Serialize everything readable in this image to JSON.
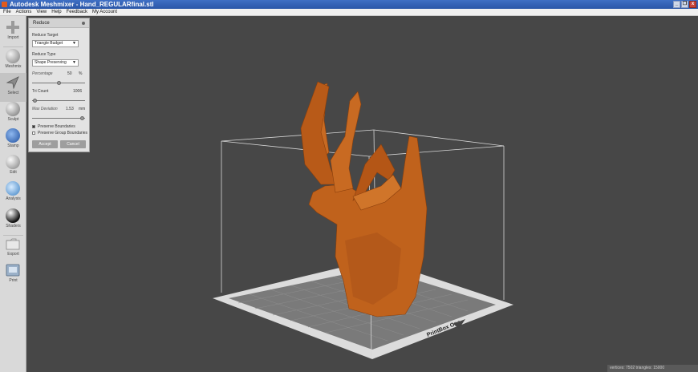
{
  "window": {
    "title": "Autodesk Meshmixer - Hand_REGULARfinal.stl",
    "buttons": [
      "_",
      "❐",
      "x"
    ]
  },
  "menu": [
    "File",
    "Actions",
    "View",
    "Help",
    "Feedback",
    "My Account"
  ],
  "tools": [
    {
      "label": "Import",
      "icon": "plus-icon"
    },
    {
      "label": "Meshmix",
      "icon": "meshmix-sphere-icon"
    },
    {
      "label": "Select",
      "icon": "select-arrow-icon",
      "active": true
    },
    {
      "label": "Sculpt",
      "icon": "sculpt-brush-icon"
    },
    {
      "label": "Stamp",
      "icon": "stamp-icon"
    },
    {
      "label": "Edit",
      "icon": "edit-sphere-icon"
    },
    {
      "label": "Analysis",
      "icon": "analysis-sphere-icon"
    },
    {
      "label": "Shaders",
      "icon": "shaders-sphere-icon"
    },
    {
      "label": "Export",
      "icon": "export-folder-icon"
    },
    {
      "label": "Print",
      "icon": "printer-icon"
    }
  ],
  "reduce_panel": {
    "title": "Reduce",
    "reduce_target_label": "Reduce Target",
    "reduce_target_value": "Triangle Budget",
    "reduce_type_label": "Reduce Type",
    "reduce_type_value": "Shape Preserving",
    "percentage_label": "Percentage",
    "percentage_value": "50",
    "percentage_unit": "%",
    "percentage_slider_level": 0.5,
    "tri_count_label": "Tri Count",
    "tri_count_value": "1006",
    "tri_count_slider_level": 0.05,
    "max_deviation_label": "Max Deviation",
    "max_deviation_value": "1.53",
    "max_deviation_unit": "mm",
    "max_deviation_slider_level": 0.95,
    "preserve_boundaries_label": "Preserve Boundaries",
    "preserve_boundaries_checked": true,
    "preserve_group_boundaries_label": "Preserve Group Boundaries",
    "preserve_group_boundaries_checked": false,
    "accept_label": "Accept",
    "cancel_label": "Cancel"
  },
  "viewport": {
    "build_plate_label": "PrintBox One",
    "model_color": "#c0621c",
    "background_color": "#474747"
  },
  "status": "vertices: 7502 triangles: 15000"
}
